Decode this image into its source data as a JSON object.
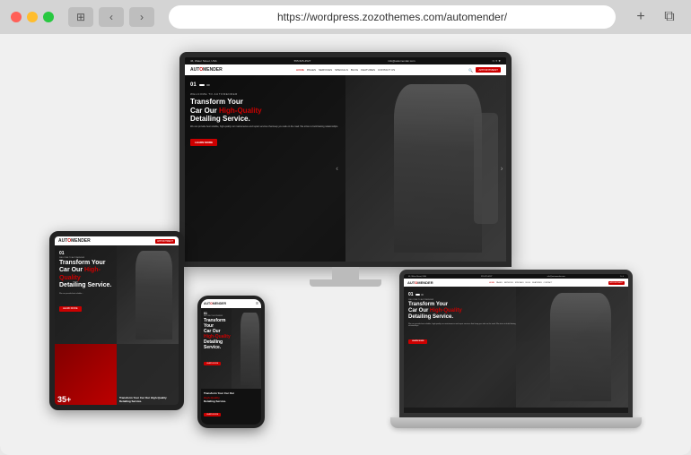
{
  "browser": {
    "url": "https://wordpress.zozothemes.com/automender/",
    "add_tab_label": "+",
    "copy_label": "⧉"
  },
  "site": {
    "topbar": {
      "address": "46, Water Street, USA",
      "phone": "555-525-4527",
      "email": "info@automender.com"
    },
    "nav": {
      "logo_prefix": "AUT",
      "logo_highlight": "O",
      "logo_suffix": "MENDER",
      "links": [
        "HOME",
        "PAGES",
        "SERVICES",
        "SPECIALS",
        "BLOG",
        "FEATURES",
        "CONTACT US"
      ],
      "active": "HOME",
      "cta_button": "APPOINTMENT"
    },
    "hero": {
      "slide_number": "01",
      "welcome_text": "WELCOME TO AUTOMENDER",
      "title_line1": "Transform Your",
      "title_line2": "Car Our ",
      "title_highlight": "High-Quality",
      "title_line3": "Detailing Service.",
      "description": "We can provide best reliable, high-quality car maintenance and repair services that keep you safe on the road. We strive to build lasting relationships.",
      "cta_button": "LEARN MORE"
    },
    "tablet_extra": {
      "stat_number": "35+",
      "stat_label": "Transform Your Car Our High-Quality Detailing Service."
    }
  }
}
